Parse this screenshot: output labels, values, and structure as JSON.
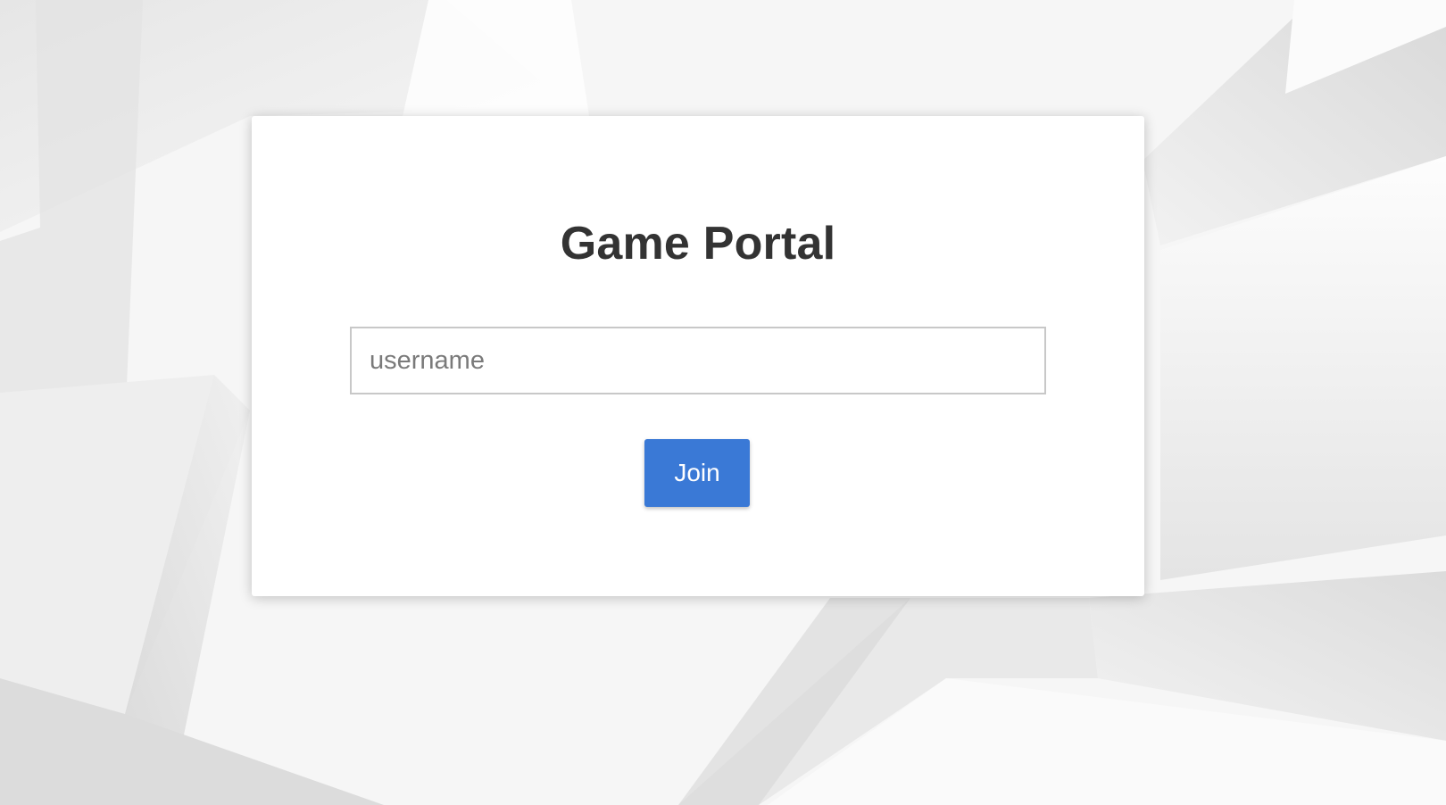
{
  "page": {
    "title": "Game Portal"
  },
  "login_form": {
    "username_placeholder": "username",
    "username_value": "",
    "join_label": "Join"
  },
  "colors": {
    "background": "#f4f4f4",
    "card": "#ffffff",
    "title_text": "#333333",
    "button": "#3a79d6",
    "button_text": "#ffffff",
    "input_border": "#c8c8c8"
  }
}
